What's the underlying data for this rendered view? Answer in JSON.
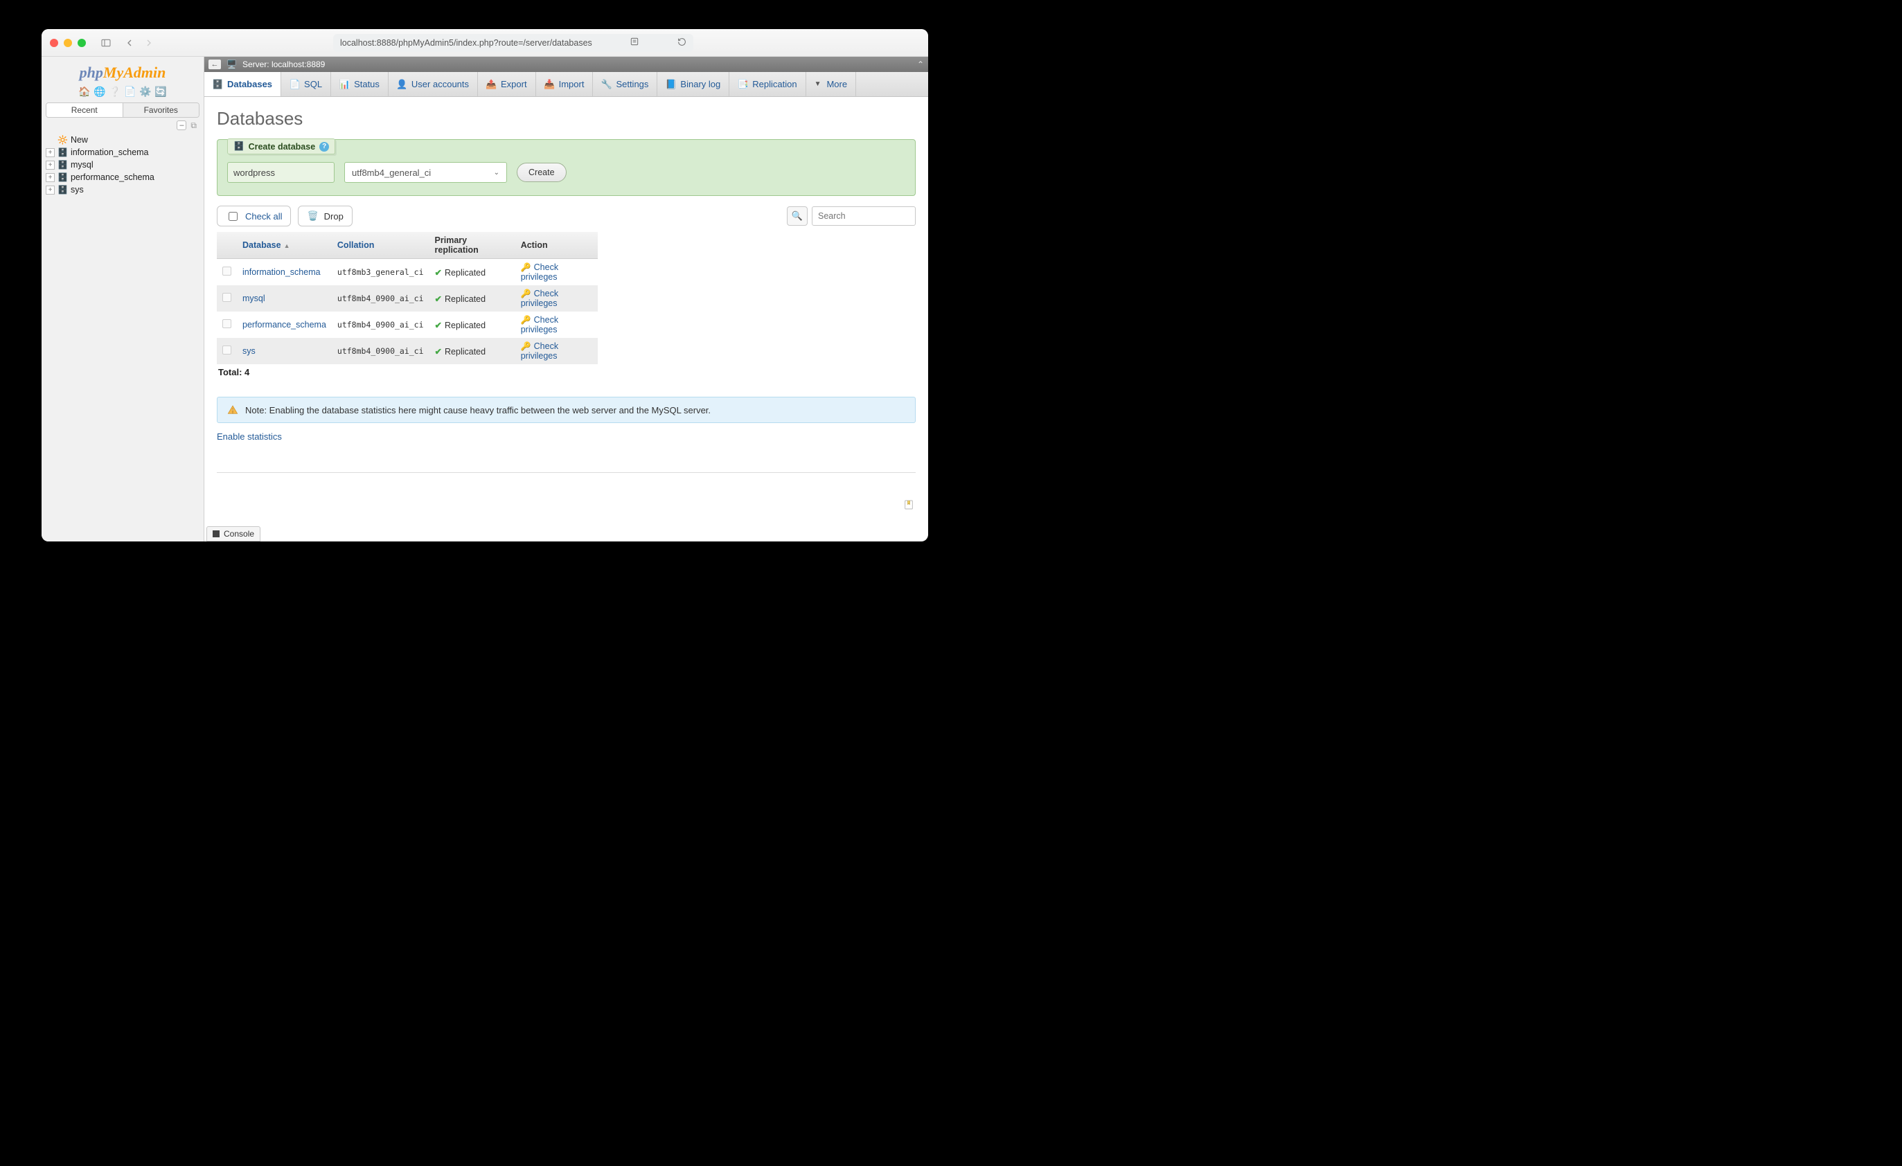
{
  "browser": {
    "url": "localhost:8888/phpMyAdmin5/index.php?route=/server/databases"
  },
  "logo": {
    "part1": "php",
    "part2": "MyAdmin"
  },
  "sidebar": {
    "tab_recent": "Recent",
    "tab_favorites": "Favorites",
    "new_label": "New",
    "items": [
      {
        "name": "information_schema"
      },
      {
        "name": "mysql"
      },
      {
        "name": "performance_schema"
      },
      {
        "name": "sys"
      }
    ]
  },
  "breadcrumb": {
    "server_label": "Server: localhost:8889"
  },
  "tabs": {
    "databases": "Databases",
    "sql": "SQL",
    "status": "Status",
    "users": "User accounts",
    "export": "Export",
    "import": "Import",
    "settings": "Settings",
    "binlog": "Binary log",
    "replication": "Replication",
    "more": "More"
  },
  "page": {
    "title": "Databases",
    "create_legend": "Create database",
    "dbname_value": "wordpress",
    "collation_value": "utf8mb4_general_ci",
    "create_btn": "Create",
    "check_all": "Check all",
    "drop": "Drop",
    "search_placeholder": "Search",
    "header_db": "Database",
    "header_collation": "Collation",
    "header_primary": "Primary replication",
    "header_action": "Action",
    "replicated": "Replicated",
    "check_priv": "Check privileges",
    "total_label": "Total: 4",
    "note": "Note: Enabling the database statistics here might cause heavy traffic between the web server and the MySQL server.",
    "enable_stats": "Enable statistics",
    "console": "Console"
  },
  "rows": [
    {
      "name": "information_schema",
      "collation": "utf8mb3_general_ci"
    },
    {
      "name": "mysql",
      "collation": "utf8mb4_0900_ai_ci"
    },
    {
      "name": "performance_schema",
      "collation": "utf8mb4_0900_ai_ci"
    },
    {
      "name": "sys",
      "collation": "utf8mb4_0900_ai_ci"
    }
  ]
}
